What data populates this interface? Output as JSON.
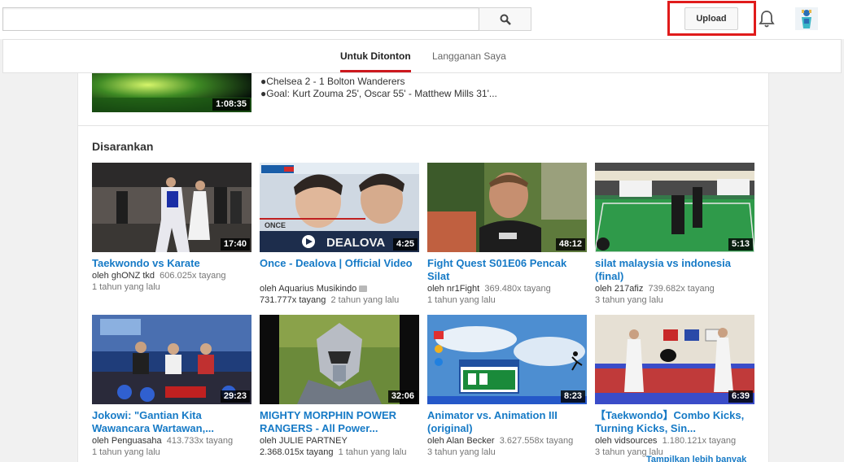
{
  "search": {
    "value": "",
    "placeholder": ""
  },
  "header": {
    "upload_label": "Upload"
  },
  "tabs": [
    {
      "label": "Untuk Ditonton"
    },
    {
      "label": "Langganan Saya"
    }
  ],
  "previous": {
    "duration": "1:08:35",
    "desc_lines": [
      "●Chelsea 2 - 1 Bolton Wanderers",
      "●Goal: Kurt Zouma 25', Oscar 55' - Matthew Mills 31'..."
    ]
  },
  "section": {
    "title": "Disarankan",
    "show_more": "Tampilkan lebih banyak"
  },
  "videos": [
    {
      "title": "Taekwondo vs Karate",
      "channel": "oleh ghONZ tkd",
      "views": "606.025x tayang",
      "age": "1 tahun yang lalu",
      "duration": "17:40"
    },
    {
      "title": "Once - Dealova | Official Video",
      "channel": "oleh Aquarius Musikindo",
      "views": "731.777x tayang",
      "age": "2 tahun yang lalu",
      "duration": "4:25",
      "thumb_text": "DEALOVA",
      "thumb_small": "ONCE"
    },
    {
      "title": "Fight Quest S01E06 Pencak Silat",
      "channel": "oleh nr1Fight",
      "views": "369.480x tayang",
      "age": "1 tahun yang lalu",
      "duration": "48:12"
    },
    {
      "title": "silat malaysia vs indonesia (final)",
      "channel": "oleh 217afiz",
      "views": "739.682x tayang",
      "age": "3 tahun yang lalu",
      "duration": "5:13"
    },
    {
      "title": "Jokowi: \"Gantian Kita Wawancara Wartawan,...",
      "channel": "oleh Penguasaha",
      "views": "413.733x tayang",
      "age": "1 tahun yang lalu",
      "duration": "29:23"
    },
    {
      "title": "MIGHTY MORPHIN POWER RANGERS - All Power...",
      "channel": "oleh JULIE PARTNEY",
      "views": "2.368.015x tayang",
      "age": "1 tahun yang lalu",
      "duration": "32:06"
    },
    {
      "title": "Animator vs. Animation III (original)",
      "channel": "oleh Alan Becker",
      "views": "3.627.558x tayang",
      "age": "3 tahun yang lalu",
      "duration": "8:23"
    },
    {
      "title": "【Taekwondo】Combo Kicks, Turning Kicks, Sin...",
      "channel": "oleh vidsources",
      "views": "1.180.121x tayang",
      "age": "3 tahun yang lalu",
      "duration": "6:39"
    }
  ],
  "colors": {
    "accent_red": "#cc181e",
    "link_blue": "#167ac6",
    "highlight_box": "#e01b1b"
  }
}
